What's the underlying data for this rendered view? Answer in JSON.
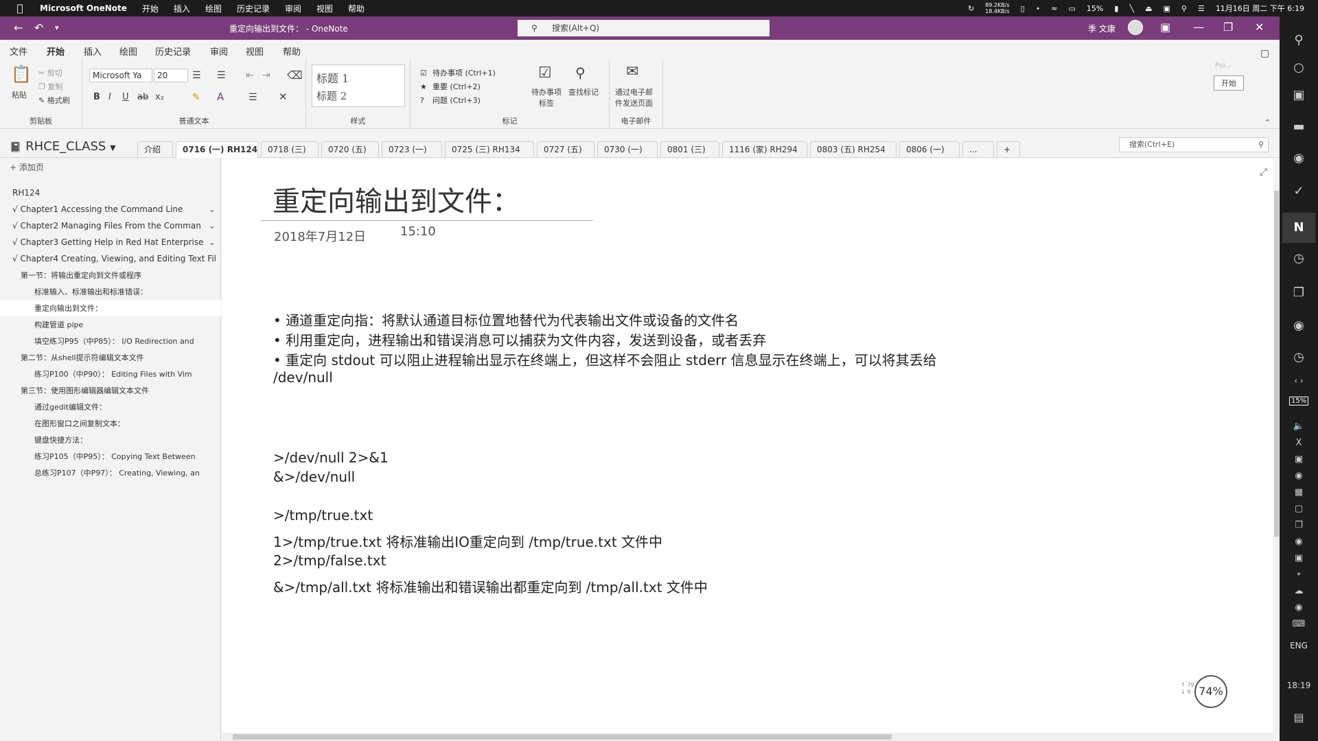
{
  "menubar": {
    "app_name": "Microsoft OneNote",
    "menus": [
      "开始",
      "插入",
      "绘图",
      "历史记录",
      "审阅",
      "视图",
      "帮助"
    ],
    "net_up": "89.2KB/s",
    "net_down": "18.4KB/s",
    "battery": "15%",
    "datetime": "11月16日 周二 下午 6:19"
  },
  "titlebar": {
    "doc_title": "重定向输出到文件：  -  OneNote",
    "search_placeholder": "搜索(Alt+Q)",
    "user_name": "季 文康"
  },
  "ribbon_tabs": [
    "文件",
    "开始",
    "插入",
    "绘图",
    "历史记录",
    "审阅",
    "视图",
    "帮助"
  ],
  "ribbon_active_tab": "开始",
  "ribbon": {
    "clipboard": {
      "paste": "粘贴",
      "cut": "剪切",
      "copy": "复制",
      "format_painter": "格式刷",
      "label": "剪贴板"
    },
    "font": {
      "name": "Microsoft Ya",
      "size": "20",
      "label": "普通文本"
    },
    "styles": {
      "heading1": "标题 1",
      "heading2": "标题 2",
      "label": "样式"
    },
    "tags": {
      "todo": "待办事项 (Ctrl+1)",
      "important": "重要 (Ctrl+2)",
      "question": "问题 (Ctrl+3)",
      "todo_tag": "待办事项\n标签",
      "find_tags": "查找标记",
      "label": "标记"
    },
    "email": {
      "send": "通过电子邮\n件发送页面",
      "label": "电子邮件"
    },
    "side": {
      "placeholder": "Poi...",
      "start": "开始"
    }
  },
  "notebook": {
    "name": "RHCE_CLASS",
    "sections": [
      "介绍",
      "0716 (一) RH124",
      "0718 (三)",
      "0720 (五)",
      "0723 (一)",
      "0725 (三) RH134",
      "0727 (五)",
      "0730 (一)",
      "0801 (三)",
      "1116 (家) RH294",
      "0803 (五) RH254",
      "0806 (一)",
      "...",
      "+"
    ],
    "active_section": "0716 (一) RH124",
    "page_search": "搜索(Ctrl+E)"
  },
  "pages": {
    "add_page": "添加页",
    "items": [
      {
        "text": "RH124",
        "indent": 0,
        "chev": false
      },
      {
        "text": "√ Chapter1 Accessing the Command Line",
        "indent": 0,
        "chev": true
      },
      {
        "text": "√ Chapter2 Managing Files From the Comman",
        "indent": 0,
        "chev": true
      },
      {
        "text": "√ Chapter3 Getting Help in Red Hat Enterprise",
        "indent": 0,
        "chev": true
      },
      {
        "text": "√ Chapter4 Creating, Viewing, and Editing Text Fil",
        "indent": 0,
        "chev": false
      },
      {
        "text": "第一节：将输出重定向到文件或程序",
        "indent": 1,
        "chev": false
      },
      {
        "text": "标准输入、标准输出和标准错误：",
        "indent": 2,
        "chev": false
      },
      {
        "text": "重定向输出到文件：",
        "indent": 2,
        "chev": false,
        "selected": true
      },
      {
        "text": "构建管道 pipe",
        "indent": 2,
        "chev": false
      },
      {
        "text": "填空练习P95（中P85）： I/O Redirection and",
        "indent": 2,
        "chev": false
      },
      {
        "text": "第二节：从shell提示符编辑文本文件",
        "indent": 1,
        "chev": false
      },
      {
        "text": "练习P100（中P90）： Editing Files with Vim",
        "indent": 2,
        "chev": false
      },
      {
        "text": "第三节：使用图形编辑器编辑文本文件",
        "indent": 1,
        "chev": false
      },
      {
        "text": "通过gedit编辑文件：",
        "indent": 2,
        "chev": false
      },
      {
        "text": "在图形窗口之间复制文本：",
        "indent": 2,
        "chev": false
      },
      {
        "text": "键盘快捷方法：",
        "indent": 2,
        "chev": false
      },
      {
        "text": "练习P105（中P95）： Copying Text Between",
        "indent": 2,
        "chev": false
      },
      {
        "text": "总练习P107（中P97）： Creating, Viewing, an",
        "indent": 2,
        "chev": false
      }
    ]
  },
  "note": {
    "title": "重定向输出到文件：",
    "date": "2018年7月12日",
    "time": "15:10",
    "lines": [
      "• 通道重定向指：将默认通道目标位置地替代为代表输出文件或设备的文件名",
      "• 利用重定向，进程输出和错误消息可以捕获为文件内容，发送到设备，或者丢弃",
      "• 重定向 stdout 可以阻止进程输出显示在终端上，但这样不会阻止 stderr 信息显示在终端上，可以将其丢给",
      "/dev/null",
      ">/dev/null 2>&1",
      "&>/dev/null",
      ">/tmp/true.txt",
      "1>/tmp/true.txt 将标准输出IO重定向到 /tmp/true.txt 文件中",
      "2>/tmp/false.txt",
      "&>/tmp/all.txt 将标准输出和错误输出都重定向到 /tmp/all.txt 文件中"
    ]
  },
  "zoom": {
    "value": "74%",
    "mini_up": "↑ 79",
    "mini_down": "↓ 9"
  },
  "right_sidebar": {
    "battery": "15%",
    "input_lang": "ENG",
    "clock": "18:19"
  },
  "colors": {
    "accent": "#7a3c7a",
    "menubar": "#1c1c1c",
    "sidebar": "#1d1d1d"
  }
}
